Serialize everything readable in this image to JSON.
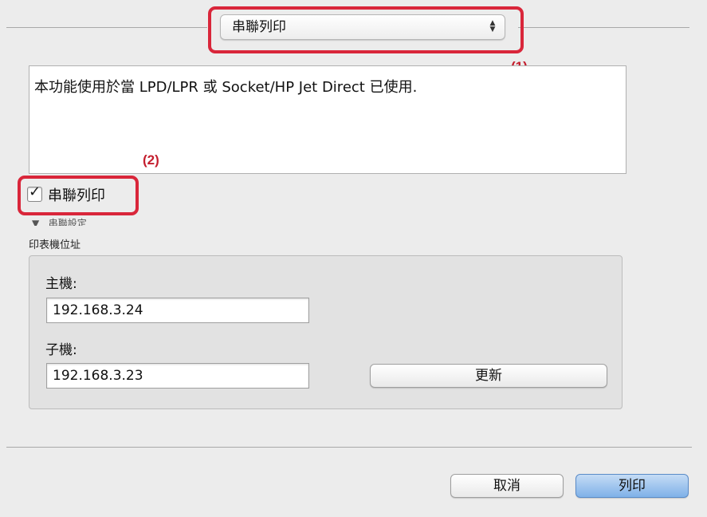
{
  "dialog": {
    "popup_selected": "串聯列印",
    "callouts": {
      "one": "(1)",
      "two": "(2)"
    },
    "description": "本功能使用於當 LPD/LPR 或 Socket/HP Jet Direct 已使用.",
    "tandem_checkbox": {
      "label": "串聯列印",
      "checked": true
    },
    "disclosure_label": "串聯設定",
    "printer_address_label": "印表機位址",
    "master": {
      "label": "主機:",
      "value": "192.168.3.24"
    },
    "slave": {
      "label": "子機:",
      "value": "192.168.3.23"
    },
    "update_button": "更新",
    "cancel_button": "取消",
    "print_button": "列印"
  },
  "colors": {
    "highlight": "#d9263a",
    "default_button": "#7fb1e8"
  }
}
